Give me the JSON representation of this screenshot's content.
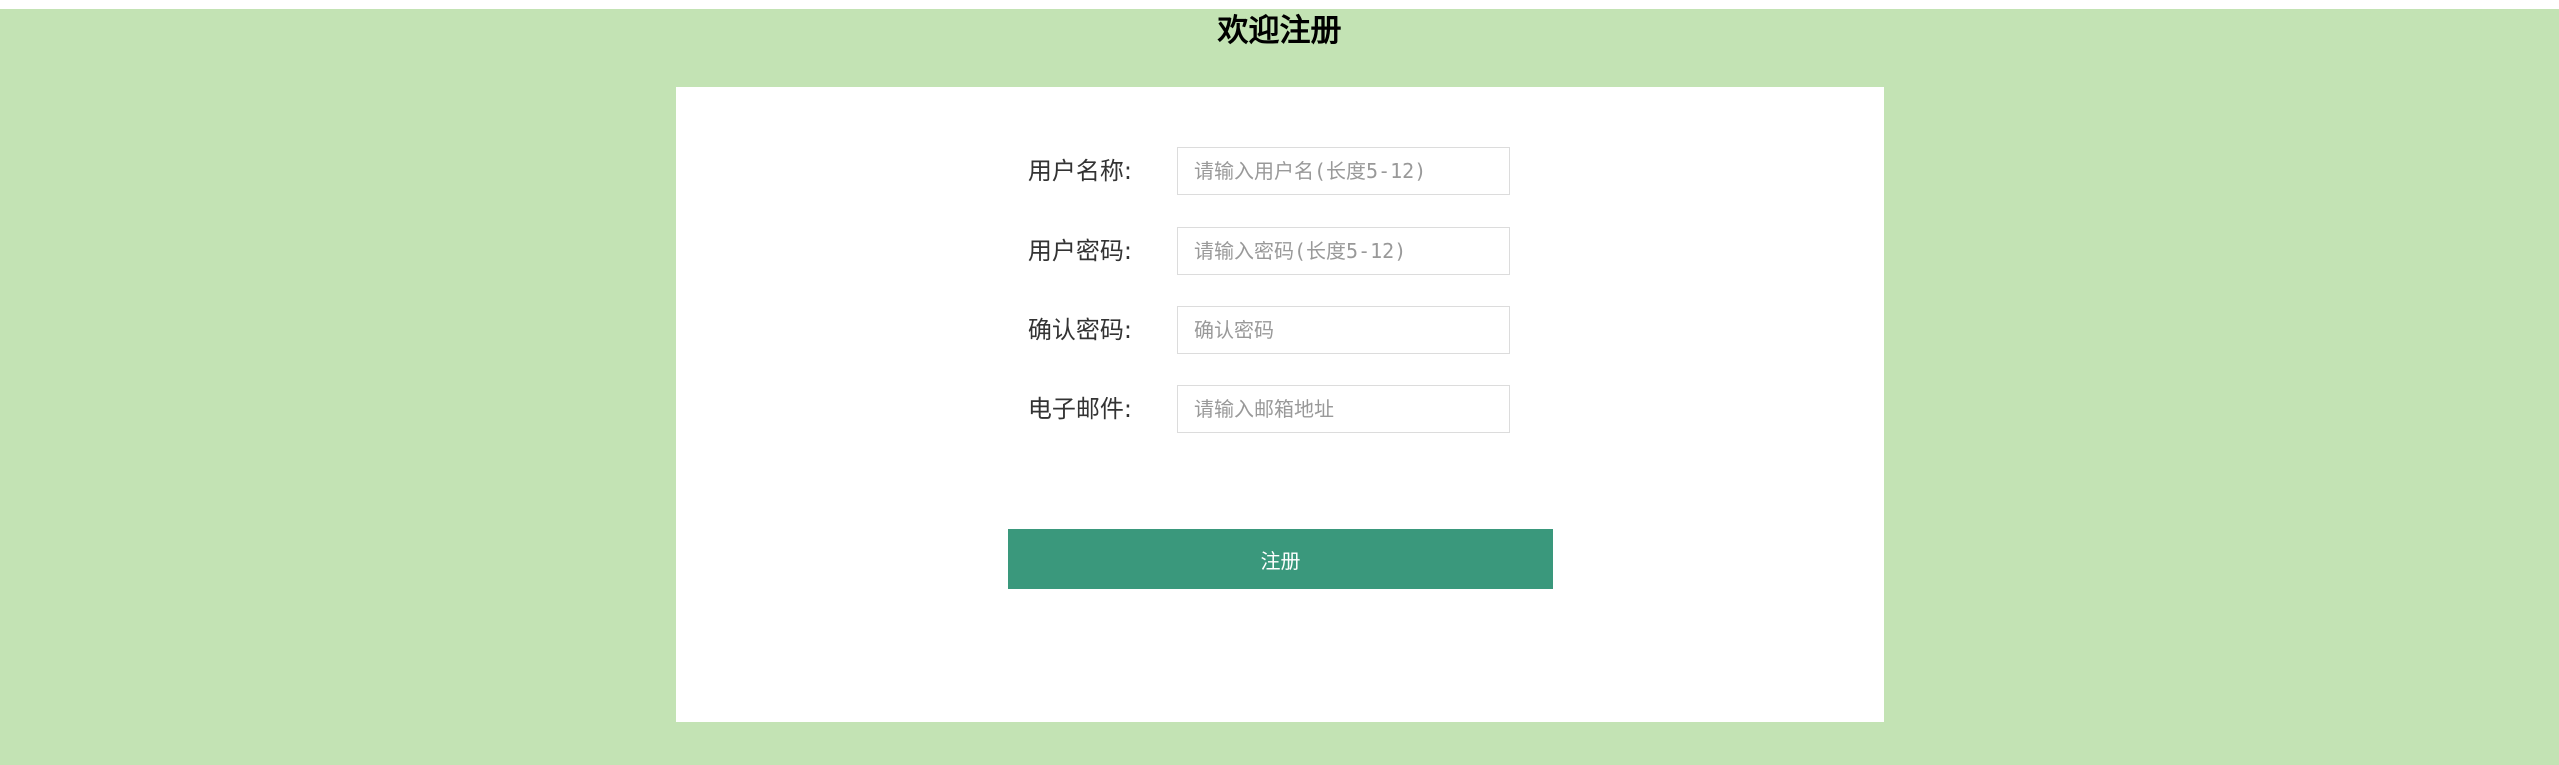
{
  "page": {
    "title": "欢迎注册"
  },
  "form": {
    "fields": [
      {
        "label": "用户名称:",
        "placeholder": "请输入用户名(长度5-12)",
        "value": ""
      },
      {
        "label": "用户密码:",
        "placeholder": "请输入密码(长度5-12)",
        "value": ""
      },
      {
        "label": "确认密码:",
        "placeholder": "确认密码",
        "value": ""
      },
      {
        "label": "电子邮件:",
        "placeholder": "请输入邮箱地址",
        "value": ""
      }
    ],
    "submit_label": "注册"
  },
  "colors": {
    "background": "#c3e3b4",
    "card": "#ffffff",
    "button": "#3a987c",
    "button_text": "#ffffff",
    "label_text": "#333333"
  }
}
